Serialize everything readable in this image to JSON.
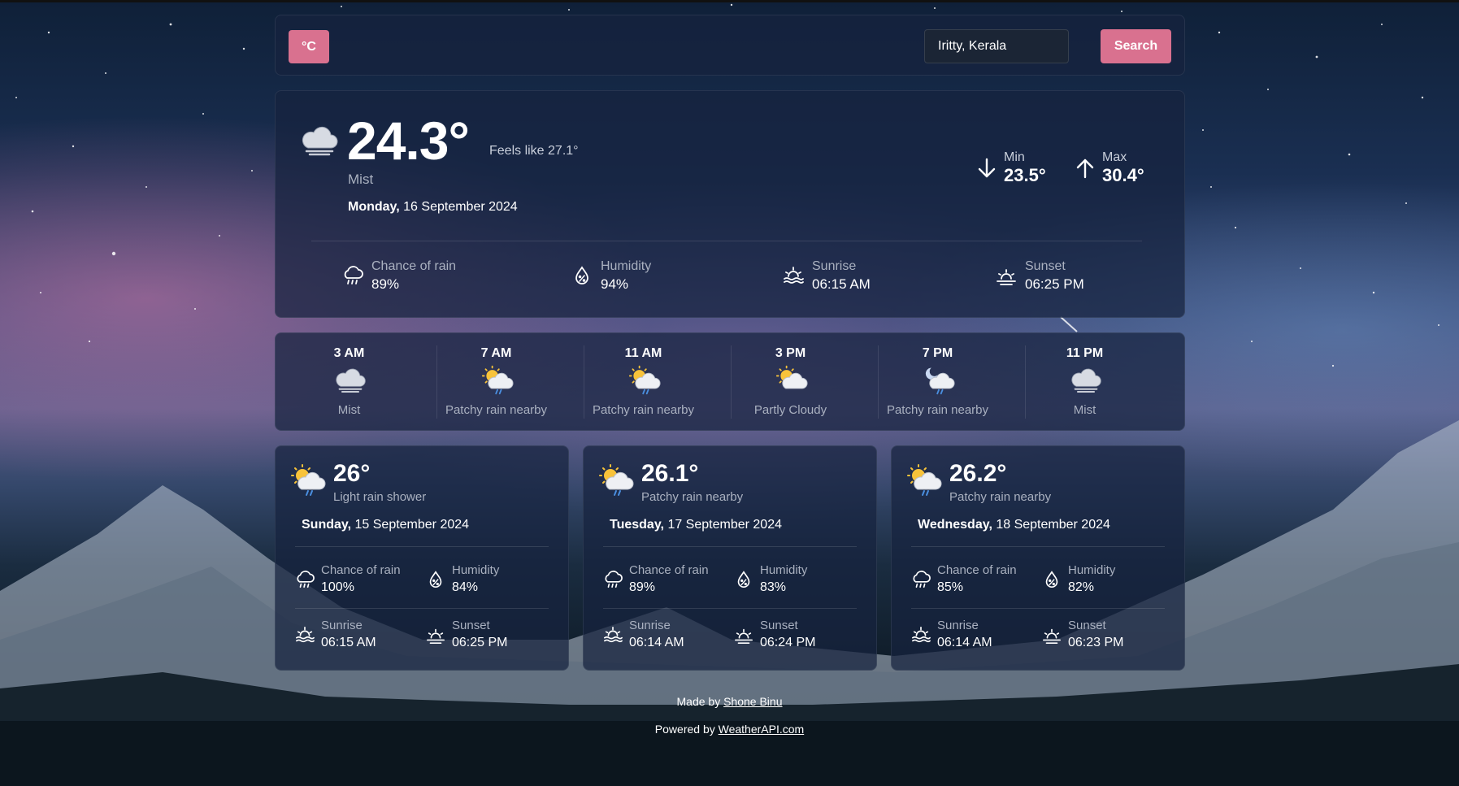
{
  "header": {
    "unit_button": "°C",
    "search_value": "Iritty, Kerala",
    "search_button": "Search"
  },
  "current": {
    "temp": "24.3°",
    "feels_like": "Feels like 27.1°",
    "condition": "Mist",
    "day": "Monday,",
    "date": "16 September 2024",
    "min_label": "Min",
    "min_value": "23.5°",
    "max_label": "Max",
    "max_value": "30.4°",
    "icon": "cloud-icon",
    "stats": [
      {
        "label": "Chance of rain",
        "value": "89%",
        "icon": "rain-icon"
      },
      {
        "label": "Humidity",
        "value": "94%",
        "icon": "humidity-icon"
      },
      {
        "label": "Sunrise",
        "value": "06:15 AM",
        "icon": "sunrise-icon"
      },
      {
        "label": "Sunset",
        "value": "06:25 PM",
        "icon": "sunset-icon"
      }
    ]
  },
  "hourly": [
    {
      "time": "3 AM",
      "condition": "Mist",
      "icon": "cloud-icon"
    },
    {
      "time": "7 AM",
      "condition": "Patchy rain nearby",
      "icon": "sun-cloud-rain-icon"
    },
    {
      "time": "11 AM",
      "condition": "Patchy rain nearby",
      "icon": "sun-cloud-rain-icon"
    },
    {
      "time": "3 PM",
      "condition": "Partly Cloudy",
      "icon": "sun-cloud-icon"
    },
    {
      "time": "7 PM",
      "condition": "Patchy rain nearby",
      "icon": "moon-cloud-rain-icon"
    },
    {
      "time": "11 PM",
      "condition": "Mist",
      "icon": "cloud-icon"
    }
  ],
  "forecast": [
    {
      "temp": "26°",
      "condition": "Light rain shower",
      "day": "Sunday,",
      "date": "15 September 2024",
      "rain_label": "Chance of rain",
      "rain": "100%",
      "humidity_label": "Humidity",
      "humidity": "84%",
      "sunrise_label": "Sunrise",
      "sunrise": "06:15 AM",
      "sunset_label": "Sunset",
      "sunset": "06:25 PM"
    },
    {
      "temp": "26.1°",
      "condition": "Patchy rain nearby",
      "day": "Tuesday,",
      "date": "17 September 2024",
      "rain_label": "Chance of rain",
      "rain": "89%",
      "humidity_label": "Humidity",
      "humidity": "83%",
      "sunrise_label": "Sunrise",
      "sunrise": "06:14 AM",
      "sunset_label": "Sunset",
      "sunset": "06:24 PM"
    },
    {
      "temp": "26.2°",
      "condition": "Patchy rain nearby",
      "day": "Wednesday,",
      "date": "18 September 2024",
      "rain_label": "Chance of rain",
      "rain": "85%",
      "humidity_label": "Humidity",
      "humidity": "82%",
      "sunrise_label": "Sunrise",
      "sunrise": "06:14 AM",
      "sunset_label": "Sunset",
      "sunset": "06:23 PM"
    }
  ],
  "footer": {
    "made_by_prefix": "Made by",
    "author": "Shone Binu",
    "powered_prefix": "Powered by",
    "provider": "WeatherAPI.com"
  },
  "colors": {
    "accent": "#d9718f",
    "panel": "#16223e"
  }
}
